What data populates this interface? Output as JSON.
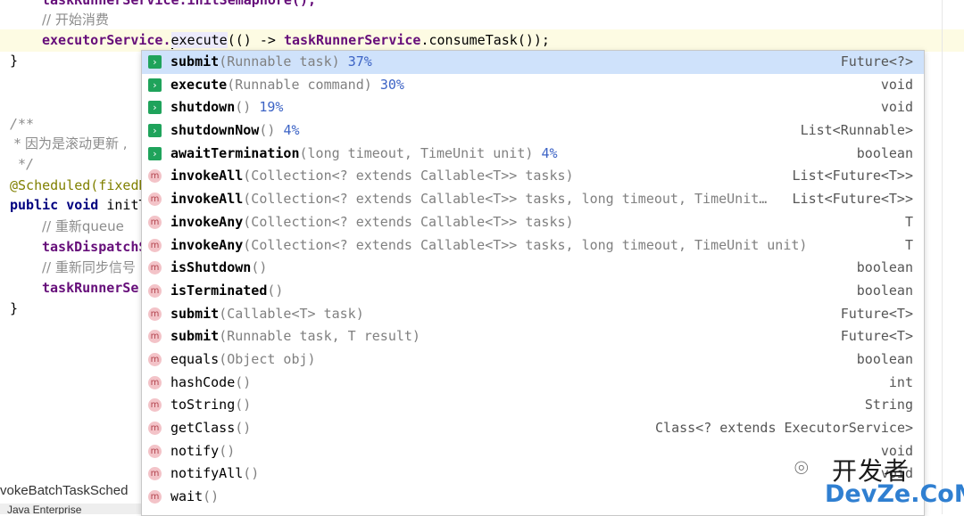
{
  "editor": {
    "lines": {
      "l0": "taskRunnerService.initSemaphore();",
      "l1": "// 开始消费",
      "l2_obj": "executorService.",
      "l2_method": "execute",
      "l2_rest_a": "(() -> ",
      "l2_rest_b": "taskRunnerService",
      "l2_rest_c": ".consumeTask());",
      "l3": "}",
      "l5": "/**",
      "l6": " * 因为是滚动更新 ,",
      "l7": " */",
      "l8": "@Scheduled(fixedD",
      "l9_kw": "public void ",
      "l9_name": "initT",
      "l10": "// 重新queue",
      "l11": "taskDispatchS",
      "l12": "// 重新同步信号",
      "l13": "taskRunnerSe",
      "l14": "}"
    },
    "status_text": "vokeBatchTaskSched",
    "bottom_tab": "Java Enterprise"
  },
  "completion": {
    "items": [
      {
        "icon": "executor-method-icon",
        "name": "submit",
        "params": "(Runnable task)",
        "pct": "37%",
        "ret": "Future<?>",
        "selected": true
      },
      {
        "icon": "executor-method-icon",
        "name": "execute",
        "params": "(Runnable command)",
        "pct": "30%",
        "ret": "void"
      },
      {
        "icon": "executor-method-icon",
        "name": "shutdown",
        "params": "()",
        "pct": "19%",
        "ret": "void"
      },
      {
        "icon": "executor-method-icon",
        "name": "shutdownNow",
        "params": "()",
        "pct": "4%",
        "ret": "List<Runnable>"
      },
      {
        "icon": "executor-method-icon",
        "name": "awaitTermination",
        "params": "(long timeout, TimeUnit unit)",
        "pct": "4%",
        "ret": "boolean"
      },
      {
        "icon": "method-icon",
        "name": "invokeAll",
        "params": "(Collection<? extends Callable<T>> tasks)",
        "pct": "",
        "ret": "List<Future<T>>"
      },
      {
        "icon": "method-icon",
        "name": "invokeAll",
        "params": "(Collection<? extends Callable<T>> tasks, long timeout, TimeUnit…",
        "pct": "",
        "ret": "List<Future<T>>"
      },
      {
        "icon": "method-icon",
        "name": "invokeAny",
        "params": "(Collection<? extends Callable<T>> tasks)",
        "pct": "",
        "ret": "T"
      },
      {
        "icon": "method-icon",
        "name": "invokeAny",
        "params": "(Collection<? extends Callable<T>> tasks, long timeout, TimeUnit unit)",
        "pct": "",
        "ret": "T"
      },
      {
        "icon": "method-icon",
        "name": "isShutdown",
        "params": "()",
        "pct": "",
        "ret": "boolean"
      },
      {
        "icon": "method-icon",
        "name": "isTerminated",
        "params": "()",
        "pct": "",
        "ret": "boolean"
      },
      {
        "icon": "method-icon",
        "name": "submit",
        "params": "(Callable<T> task)",
        "pct": "",
        "ret": "Future<T>"
      },
      {
        "icon": "method-icon",
        "name": "submit",
        "params": "(Runnable task, T result)",
        "pct": "",
        "ret": "Future<T>"
      },
      {
        "icon": "method-icon",
        "name": "equals",
        "params": "(Object obj)",
        "pct": "",
        "ret": "boolean",
        "plain": true
      },
      {
        "icon": "method-icon",
        "name": "hashCode",
        "params": "()",
        "pct": "",
        "ret": "int",
        "plain": true
      },
      {
        "icon": "method-icon",
        "name": "toString",
        "params": "()",
        "pct": "",
        "ret": "String",
        "plain": true
      },
      {
        "icon": "method-icon",
        "name": "getClass",
        "params": "()",
        "pct": "",
        "ret": "Class<? extends ExecutorService>",
        "plain": true
      },
      {
        "icon": "method-icon",
        "name": "notify",
        "params": "()",
        "pct": "",
        "ret": "void",
        "plain": true
      },
      {
        "icon": "method-icon",
        "name": "notifyAll",
        "params": "()",
        "pct": "",
        "ret": "void",
        "plain": true
      },
      {
        "icon": "method-icon",
        "name": "wait",
        "params": "()",
        "pct": "",
        "ret": "",
        "plain": true
      }
    ]
  },
  "watermark": {
    "top": "开发者",
    "bottom": "DevZe.CoM"
  },
  "colors": {
    "selected_row": "#cfe2fb",
    "percent": "#3c63c5",
    "keyword": "#000080",
    "field": "#660e7a",
    "comment": "#8c8c8c",
    "annotation": "#808000"
  }
}
